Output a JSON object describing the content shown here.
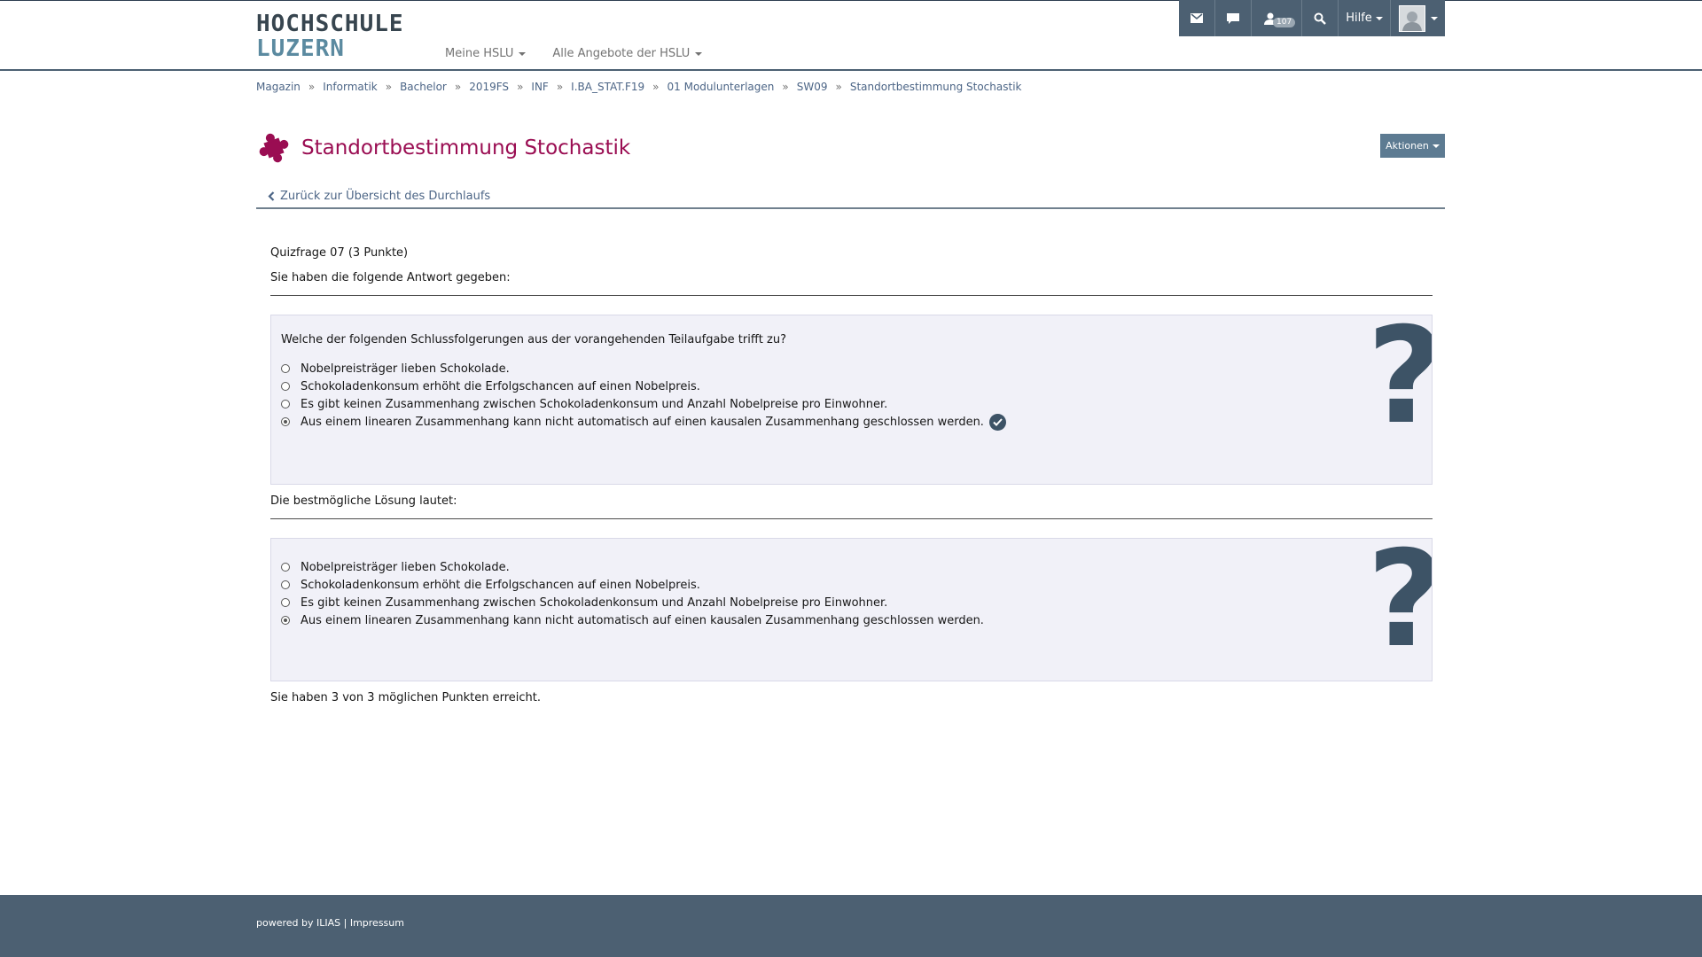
{
  "logo": {
    "line1": "HOCHSCHULE",
    "line2": "LUZERN"
  },
  "nav": {
    "items": [
      "Meine HSLU",
      "Alle Angebote der HSLU"
    ]
  },
  "topbar": {
    "badge": "107",
    "help": "Hilfe"
  },
  "breadcrumb": [
    "Magazin",
    "Informatik",
    "Bachelor",
    "2019FS",
    "INF",
    "I.BA_STAT.F19",
    "01 Modulunterlagen",
    "SW09",
    "Standortbestimmung Stochastik"
  ],
  "breadcrumb_sep": "»",
  "page": {
    "title": "Standortbestimmung Stochastik",
    "actions": "Aktionen",
    "back": "Zurück zur Übersicht des Durchlaufs"
  },
  "quiz": {
    "question_title": "Quizfrage 07 (3 Punkte)",
    "given_label": "Sie haben die folgende Antwort gegeben:",
    "question": "Welche der folgenden Schlussfolgerungen aus der vorangehenden Teilaufgabe trifft zu?",
    "options": [
      "Nobelpreisträger lieben Schokolade.",
      "Schokoladenkonsum erhöht die Erfolgschancen auf einen Nobelpreis.",
      "Es gibt keinen Zusammenhang zwischen Schokoladenkonsum und Anzahl Nobelpreise pro Einwohner.",
      "Aus einem linearen Zusammenhang kann nicht automatisch auf einen kausalen Zusammenhang geschlossen werden."
    ],
    "best_label": "Die bestmögliche Lösung lautet:",
    "result": "Sie haben 3 von 3 möglichen Punkten erreicht."
  },
  "footer": {
    "powered": "powered by ILIAS",
    "sep": " | ",
    "impressum": "Impressum"
  },
  "colors": {
    "accent": "#9a0d52",
    "bar": "#4c6072",
    "link": "#4c6586"
  }
}
